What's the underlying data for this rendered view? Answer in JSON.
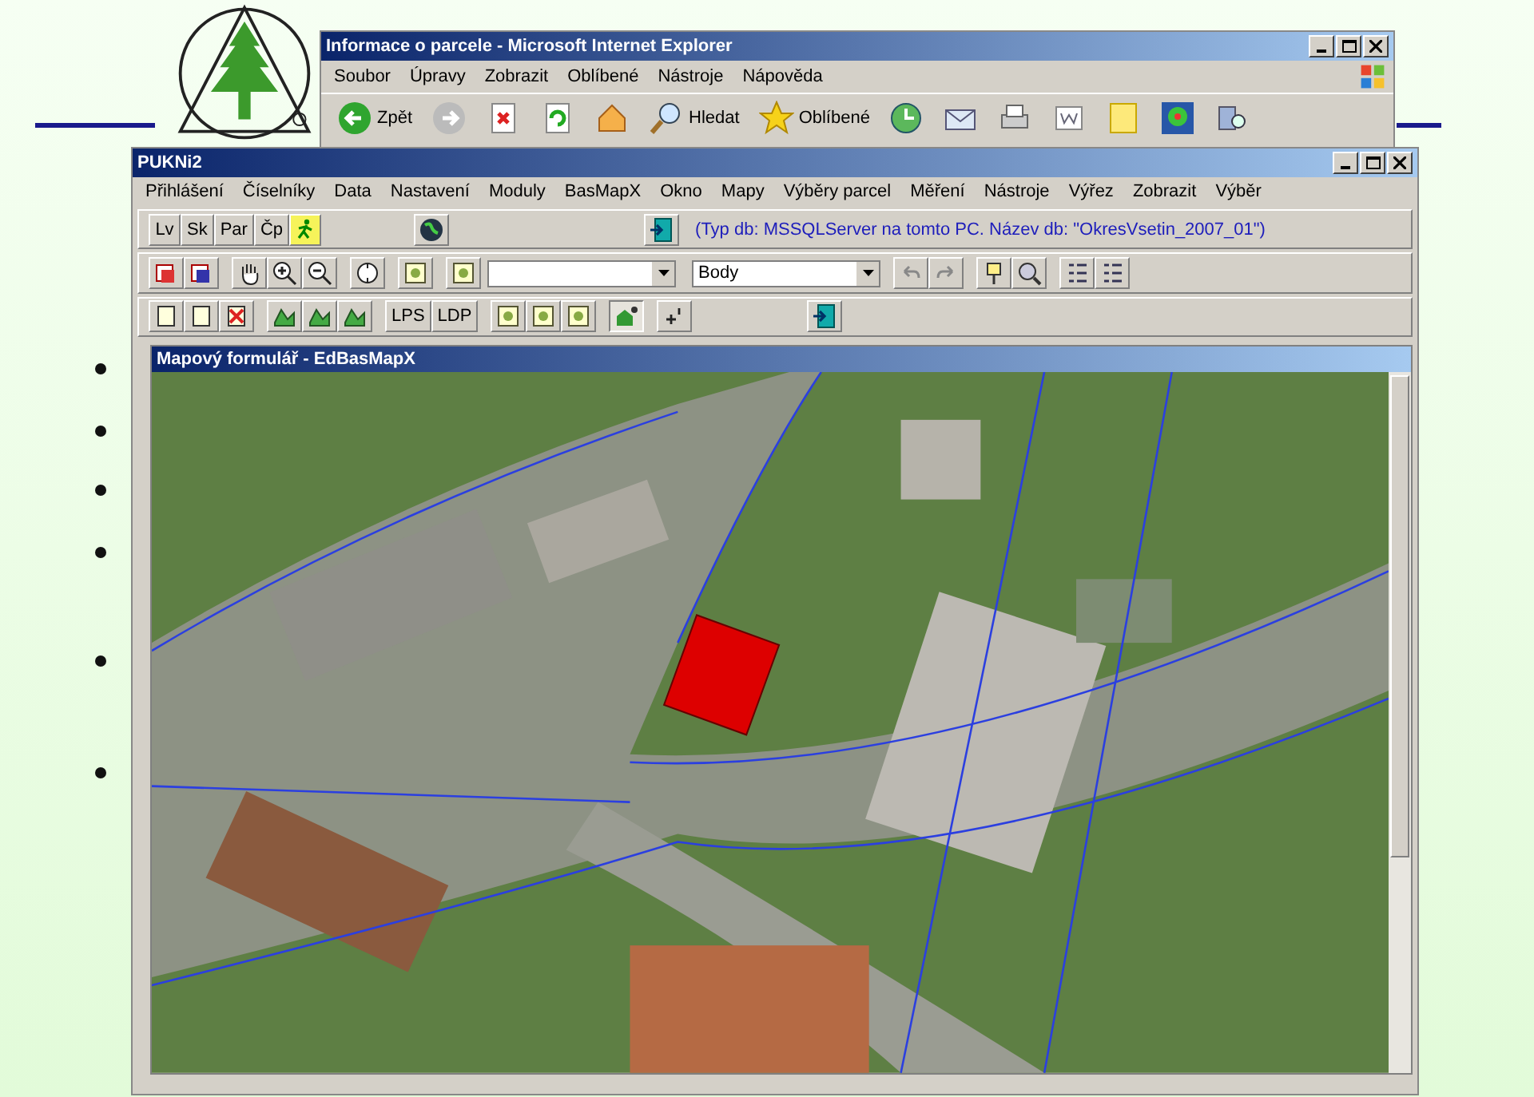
{
  "ie_window": {
    "title": "Informace o parcele - Microsoft Internet Explorer",
    "menu": [
      "Soubor",
      "Úpravy",
      "Zobrazit",
      "Oblíbené",
      "Nástroje",
      "Nápověda"
    ],
    "toolbar": [
      {
        "kind": "back",
        "label": "Zpět"
      },
      {
        "kind": "forward"
      },
      {
        "kind": "stop"
      },
      {
        "kind": "refresh"
      },
      {
        "kind": "home"
      },
      {
        "kind": "search",
        "label": "Hledat"
      },
      {
        "kind": "favorites",
        "label": "Oblíbené"
      },
      {
        "kind": "history"
      },
      {
        "kind": "mail"
      },
      {
        "kind": "print"
      },
      {
        "kind": "edit"
      },
      {
        "kind": "note"
      },
      {
        "kind": "flower"
      },
      {
        "kind": "research"
      }
    ]
  },
  "app_window": {
    "title": "PUKNi2",
    "menu": [
      "Přihlášení",
      "Číselníky",
      "Data",
      "Nastavení",
      "Moduly",
      "BasMapX",
      "Okno",
      "Mapy",
      "Výběry parcel",
      "Měření",
      "Nástroje",
      "Výřez",
      "Zobrazit",
      "Výběr"
    ],
    "row1_buttons": [
      "Lv",
      "Sk",
      "Par",
      "Čp"
    ],
    "db_info": "(Typ db: MSSQLServer na tomto PC. Název db: \"OkresVsetin_2007_01\")",
    "points_combo": {
      "value": "Body"
    },
    "row3_buttons": [
      "LPS",
      "LDP"
    ],
    "map_window": {
      "title": "Mapový formulář - EdBasMapX"
    }
  }
}
